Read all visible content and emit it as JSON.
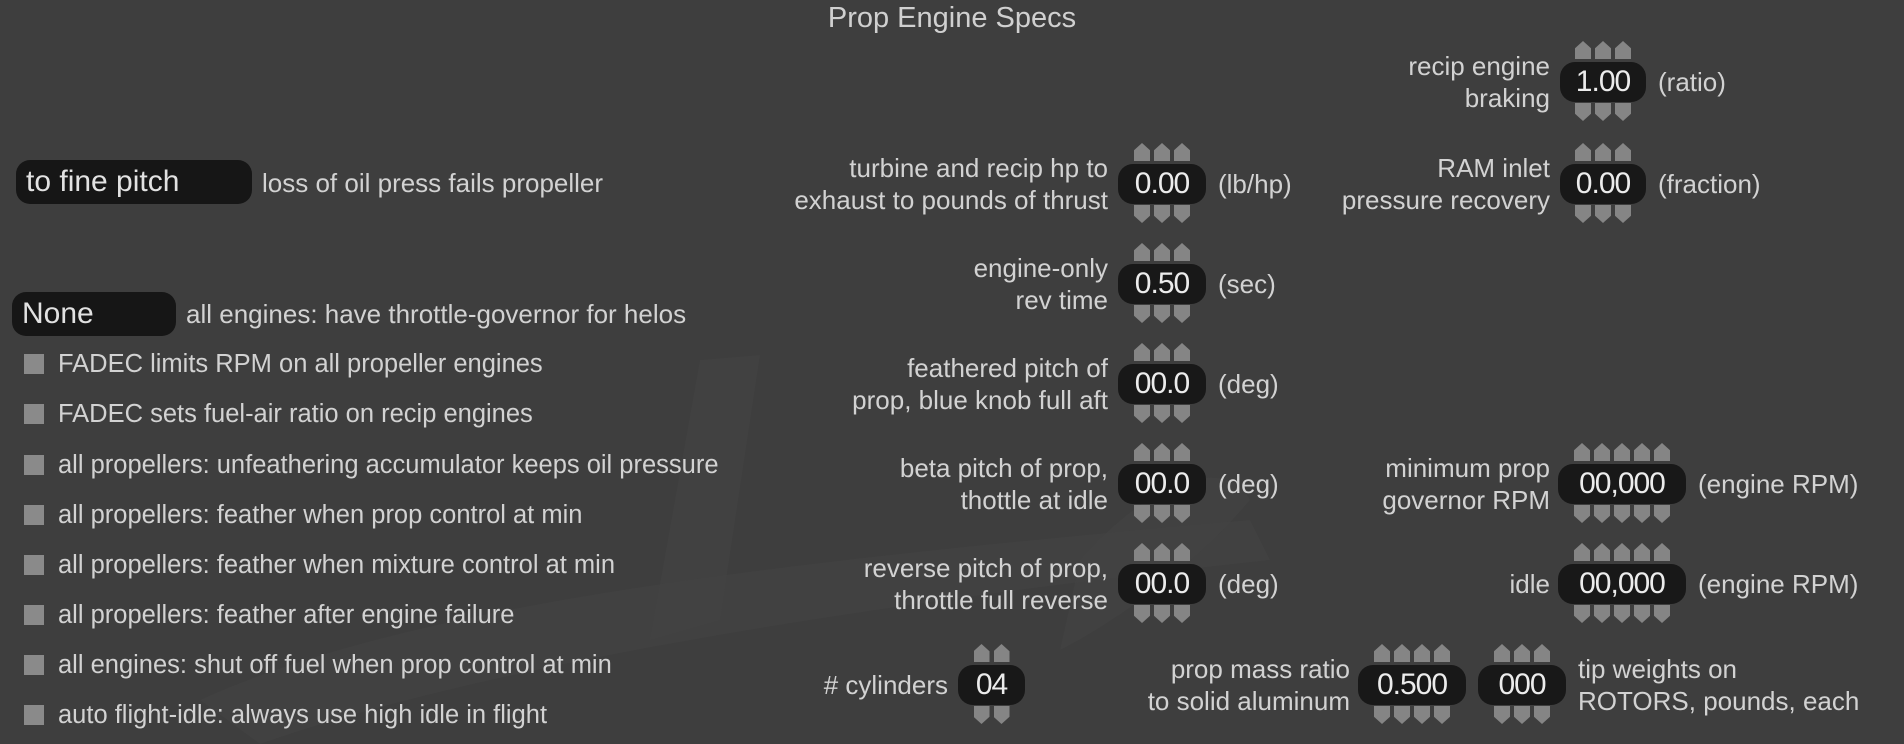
{
  "title": "Prop Engine Specs",
  "dropdowns": [
    {
      "value": "to fine pitch",
      "label": "loss of oil press fails propeller"
    },
    {
      "value": "None",
      "label": "all engines: have throttle-governor for helos"
    }
  ],
  "checkboxes": [
    {
      "label": "FADEC limits RPM on all propeller engines",
      "checked": false
    },
    {
      "label": "FADEC sets fuel-air ratio on recip engines",
      "checked": false
    },
    {
      "label": "all propellers: unfeathering accumulator keeps oil pressure",
      "checked": false
    },
    {
      "label": "all propellers: feather when prop control at min",
      "checked": false
    },
    {
      "label": "all propellers: feather when mixture control at min",
      "checked": false
    },
    {
      "label": "all propellers: feather after engine failure",
      "checked": false
    },
    {
      "label": "all engines: shut off fuel when prop control at min",
      "checked": false
    },
    {
      "label": "auto flight-idle: always use high idle in flight",
      "checked": false
    }
  ],
  "fields": {
    "recip_engine_braking": {
      "label1": "recip engine",
      "label2": "braking",
      "value": "1.00",
      "unit": "(ratio)",
      "digits": 3
    },
    "hp_to_thrust": {
      "label1": "turbine and recip hp to",
      "label2": "exhaust to pounds of thrust",
      "value": "0.00",
      "unit": "(lb/hp)",
      "digits": 3
    },
    "ram_inlet": {
      "label1": "RAM inlet",
      "label2": "pressure recovery",
      "value": "0.00",
      "unit": "(fraction)",
      "digits": 3
    },
    "rev_time": {
      "label1": "engine-only",
      "label2": "rev time",
      "value": "0.50",
      "unit": "(sec)",
      "digits": 3
    },
    "feathered_pitch": {
      "label1": "feathered pitch of",
      "label2": "prop, blue knob full aft",
      "value": "00.0",
      "unit": "(deg)",
      "digits": 3
    },
    "beta_pitch": {
      "label1": "beta pitch of prop,",
      "label2": "thottle at idle",
      "value": "00.0",
      "unit": "(deg)",
      "digits": 3
    },
    "min_governor_rpm": {
      "label1": "minimum prop",
      "label2": "governor RPM",
      "value": "00,000",
      "unit": "(engine RPM)",
      "digits": 5
    },
    "reverse_pitch": {
      "label1": "reverse pitch of prop,",
      "label2": "throttle full reverse",
      "value": "00.0",
      "unit": "(deg)",
      "digits": 3
    },
    "idle_rpm": {
      "label1": "idle",
      "value": "00,000",
      "unit": "(engine RPM)",
      "digits": 5
    },
    "cylinders": {
      "label1": "# cylinders",
      "value": "04",
      "digits": 2
    },
    "prop_mass_ratio": {
      "label1": "prop mass ratio",
      "label2": "to solid aluminum",
      "value": "0.500",
      "digits": 4
    },
    "tip_weights": {
      "label1": "tip weights on",
      "label2": "ROTORS, pounds, each",
      "value": "000",
      "digits": 3
    }
  }
}
